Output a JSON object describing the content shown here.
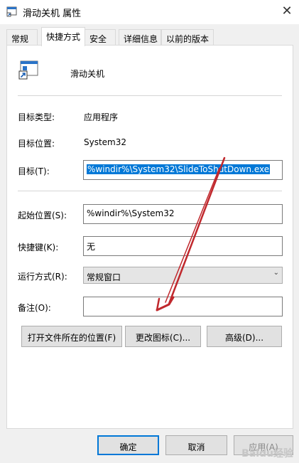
{
  "window": {
    "title": "滑动关机 属性",
    "close_glyph": "✕"
  },
  "tabs": [
    {
      "label": "常规"
    },
    {
      "label": "快捷方式"
    },
    {
      "label": "安全"
    },
    {
      "label": "详细信息"
    },
    {
      "label": "以前的版本"
    }
  ],
  "shortcut": {
    "name": "滑动关机",
    "icon": "shortcut-app-icon",
    "target_type_label": "目标类型:",
    "target_type_value": "应用程序",
    "target_location_label": "目标位置:",
    "target_location_value": "System32",
    "target_label": "目标(T):",
    "target_value": "%windir%\\System32\\SlideToShutDown.exe",
    "start_in_label": "起始位置(S):",
    "start_in_value": "%windir%\\System32",
    "hotkey_label": "快捷键(K):",
    "hotkey_value": "无",
    "run_label": "运行方式(R):",
    "run_value": "常规窗口",
    "comment_label": "备注(O):",
    "comment_value": ""
  },
  "buttons": {
    "open_location": "打开文件所在的位置(F)",
    "change_icon": "更改图标(C)...",
    "advanced": "高级(D)...",
    "ok": "确定",
    "cancel": "取消",
    "apply": "应用(A)"
  },
  "annotation": {
    "arrow_color": "#c0282d"
  },
  "watermark": "Baidu经验"
}
